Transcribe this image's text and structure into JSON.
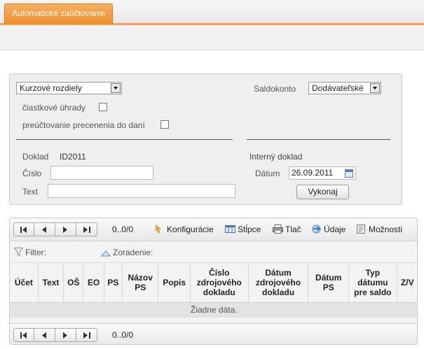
{
  "tabs": {
    "active": "Automatické zaúčtovanie"
  },
  "form": {
    "type_select": "Kurzové rozdiely",
    "saldokonto_label": "Saldokonto",
    "saldokonto_value": "Dodávateľské",
    "partial_label": "čiastkové úhrady",
    "retax_label": "preúčtovanie precenenia do daní",
    "doklad_label": "Doklad",
    "doklad_value": "ID2011",
    "cislo_label": "Číslo",
    "cislo_value": "",
    "text_label": "Text",
    "text_value": "",
    "internal_label": "Interný doklad",
    "datum_label": "Dátum",
    "datum_value": "26.09.2011",
    "execute_label": "Vykonaj"
  },
  "toolbar": {
    "page_info": "0..0/0",
    "config": "Konfigurácie",
    "columns": "Stĺpce",
    "print": "Tlač",
    "data": "Údaje",
    "options": "Možnosti"
  },
  "filterbar": {
    "filter": "Filter:",
    "sort": "Zoradenie:"
  },
  "grid": {
    "headers": [
      "Účet",
      "Text",
      "OŠ",
      "EO",
      "PS",
      "Názov PS",
      "Popis",
      "Číslo zdrojového dokladu",
      "Dátum zdrojového dokladu",
      "Dátum PS",
      "Typ dátumu pre saldo",
      "Z/V"
    ],
    "empty_message": "Žiadne dáta."
  },
  "footer": {
    "page_info": "0..0/0"
  }
}
